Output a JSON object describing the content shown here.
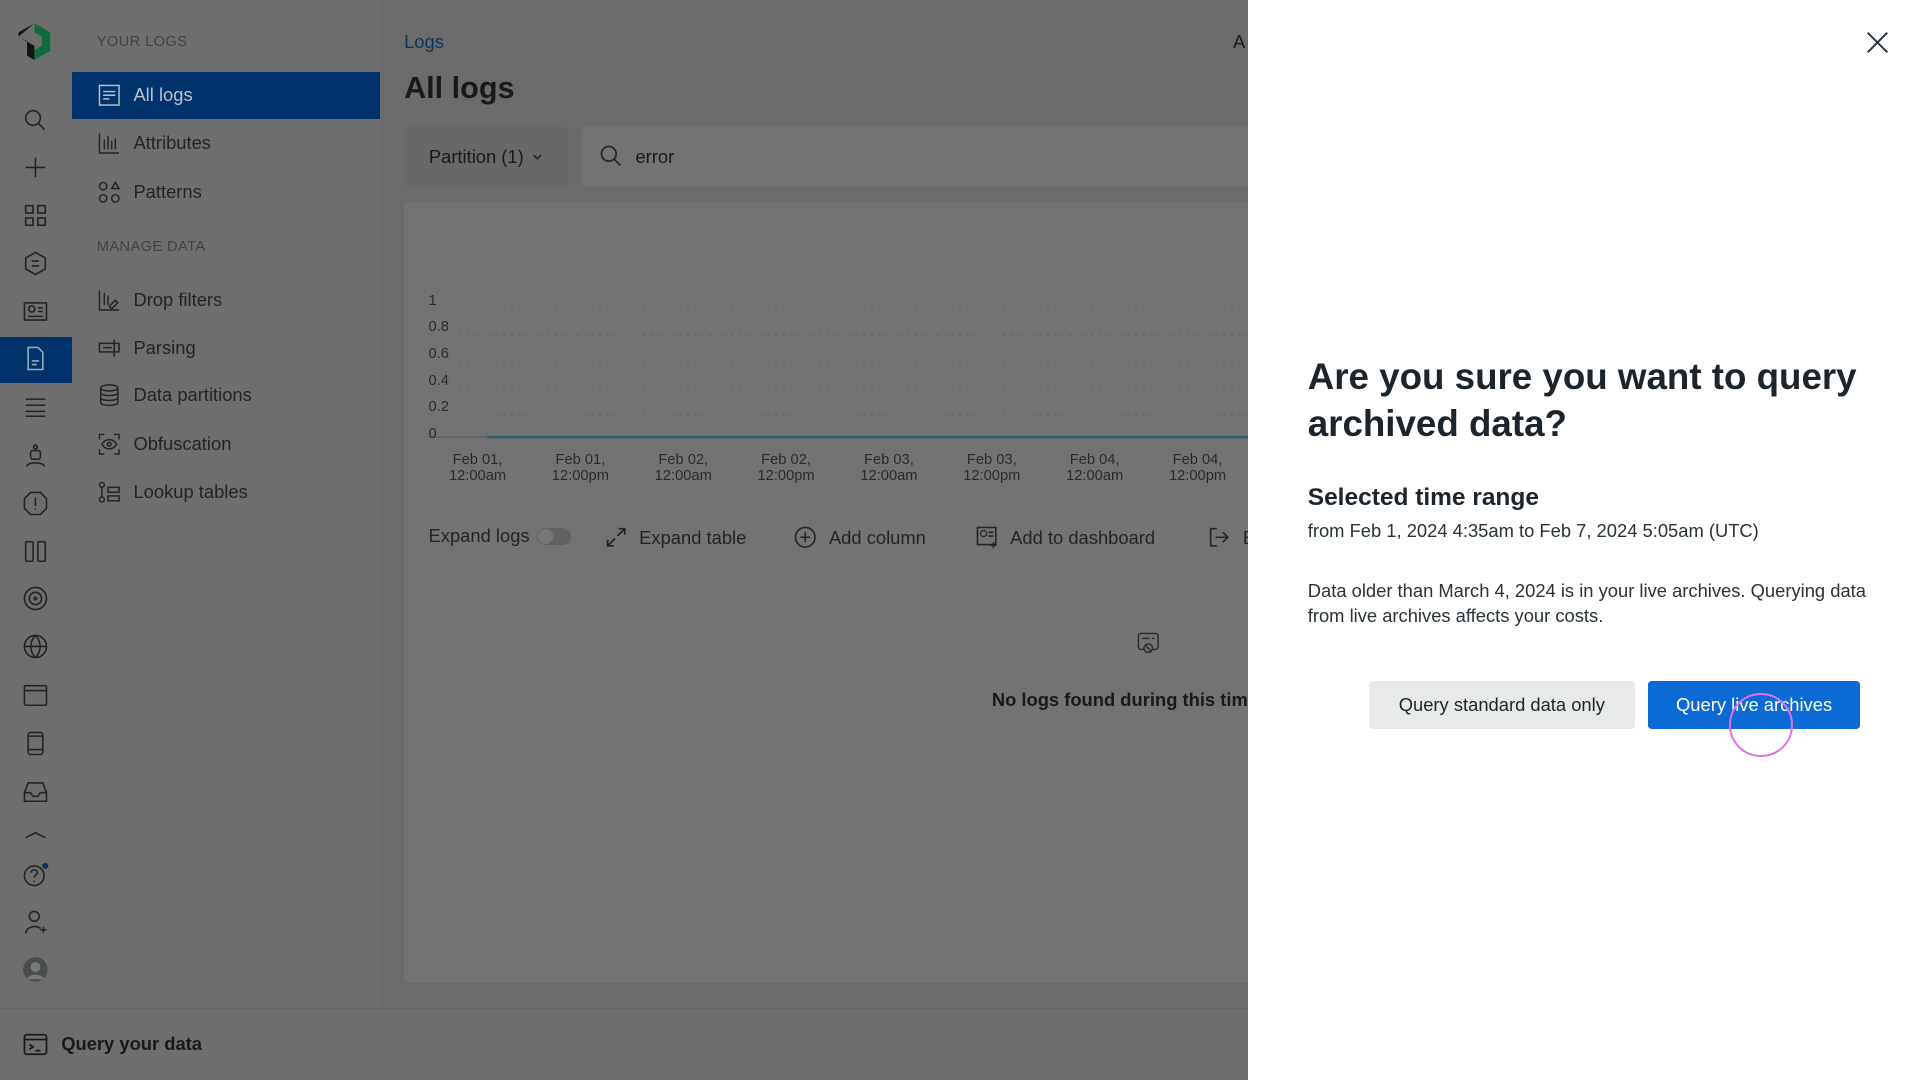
{
  "rail": {
    "icons": [
      "search-icon",
      "plus-icon",
      "apps-grid-icon",
      "entity-list-icon",
      "dashboard-icon",
      "logs-icon",
      "settings-sliders-icon",
      "ai-bot-icon",
      "alert-icon",
      "apm-icon",
      "target-icon",
      "globe-icon",
      "browser-icon",
      "mobile-icon",
      "inbox-icon",
      "more-icon",
      "help-icon",
      "add-user-icon",
      "avatar-icon"
    ],
    "selected": "logs-icon"
  },
  "nav": {
    "section1": "YOUR LOGS",
    "items1": [
      {
        "label": "All logs",
        "icon": "list-icon",
        "active": true
      },
      {
        "label": "Attributes",
        "icon": "bar-chart-icon"
      },
      {
        "label": "Patterns",
        "icon": "shapes-icon"
      }
    ],
    "section2": "MANAGE DATA",
    "items2": [
      {
        "label": "Drop filters",
        "icon": "drop-filter-icon"
      },
      {
        "label": "Parsing",
        "icon": "parsing-icon"
      },
      {
        "label": "Data partitions",
        "icon": "database-icon"
      },
      {
        "label": "Obfuscation",
        "icon": "eye-scan-icon"
      },
      {
        "label": "Lookup tables",
        "icon": "lookup-icon"
      }
    ]
  },
  "bottom": {
    "label": "Query your data",
    "icon": "terminal-icon"
  },
  "main": {
    "breadcrumb": "Logs",
    "title": "All logs",
    "header_right": "A",
    "partition_label": "Partition (1)",
    "search_value": "error",
    "toolbar": {
      "expand_logs": "Expand logs",
      "expand_logs_on": false,
      "expand_table": "Expand table",
      "add_column": "Add column",
      "add_dashboard": "Add to dashboard",
      "export": "E"
    },
    "empty_text": "No logs found during this time"
  },
  "chart_data": {
    "type": "line",
    "y_ticks": [
      "1",
      "0.8",
      "0.6",
      "0.4",
      "0.2",
      "0"
    ],
    "ylim": [
      0,
      1
    ],
    "x_ticks": [
      "Feb 01, 12:00am",
      "Feb 01, 12:00pm",
      "Feb 02, 12:00am",
      "Feb 02, 12:00pm",
      "Feb 03, 12:00am",
      "Feb 03, 12:00pm",
      "Feb 04, 12:00am",
      "Feb 04, 12:00pm"
    ],
    "values": [
      0,
      0,
      0,
      0,
      0,
      0,
      0,
      0
    ],
    "grid": true,
    "line_color": "#2a8ca6"
  },
  "dialog": {
    "title": "Are you sure you want to query archived data?",
    "subtitle": "Selected time range",
    "range": "from Feb 1, 2024 4:35am to Feb 7, 2024 5:05am (UTC)",
    "message": "Data older than March 4, 2024 is in your live archives. Querying data from live archives affects your costs.",
    "secondary_button": "Query standard data only",
    "primary_button": "Query live archives",
    "primary_color": "#0c6ad4"
  }
}
